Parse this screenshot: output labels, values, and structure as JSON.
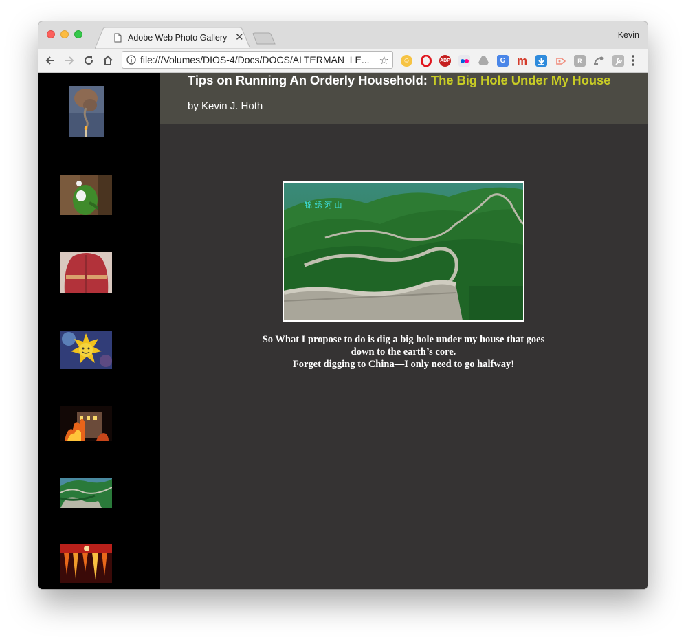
{
  "browser": {
    "tab_title": "Adobe Web Photo Gallery",
    "profile_name": "Kevin",
    "url": "file:///Volumes/DIOS-4/Docs/DOCS/ALTERMAN_LE...",
    "extensions": [
      "emoji-icon",
      "opera-icon",
      "adblock-plus-icon",
      "flickr-icon",
      "drive-icon",
      "translate-icon",
      "m-icon",
      "download-icon",
      "share-icon",
      "reader-icon",
      "satellite-icon",
      "wrench-icon"
    ],
    "abp_label": "ABP",
    "m_label": "m"
  },
  "page": {
    "title_main": "Tips on Running An Orderly Household: ",
    "title_accent": "The Big Hole Under My House",
    "byline": "by Kevin J. Hoth",
    "photo_overlay_text": "锦 绣 河 山",
    "caption_line1": "So What I propose to do is dig a big hole under my house that goes",
    "caption_line2": "down to the earth’s core.",
    "caption_line3": "Forget digging to China—I only need to go halfway!",
    "accent_color": "#c8cc25",
    "header_color": "#4c4b44",
    "content_bg": "#353333"
  },
  "sidebar": {
    "thumbnails": [
      {
        "name": "thumb-candle-smoke"
      },
      {
        "name": "thumb-green-figure"
      },
      {
        "name": "thumb-sunburned-back"
      },
      {
        "name": "thumb-sun-face"
      },
      {
        "name": "thumb-burning-building"
      },
      {
        "name": "thumb-great-wall"
      },
      {
        "name": "thumb-lava-cave"
      }
    ]
  }
}
